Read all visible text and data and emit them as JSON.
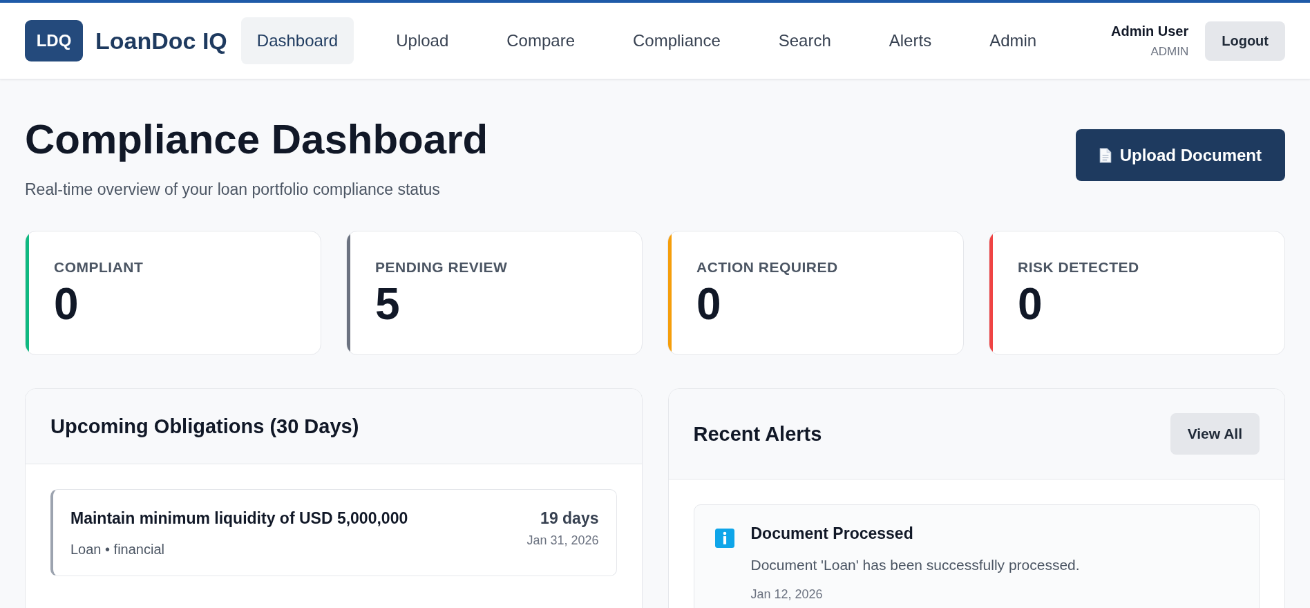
{
  "brand": {
    "logo": "LDQ",
    "name": "LoanDoc IQ"
  },
  "nav": [
    {
      "label": "Dashboard",
      "selected": true
    },
    {
      "label": "Upload",
      "selected": false
    },
    {
      "label": "Compare",
      "selected": false
    },
    {
      "label": "Compliance",
      "selected": false
    },
    {
      "label": "Search",
      "selected": false
    },
    {
      "label": "Alerts",
      "selected": false
    },
    {
      "label": "Admin",
      "selected": false
    }
  ],
  "user": {
    "name": "Admin User",
    "role": "ADMIN",
    "logout": "Logout"
  },
  "page": {
    "title": "Compliance Dashboard",
    "subtitle": "Real-time overview of your loan portfolio compliance status",
    "upload_button": "Upload Document"
  },
  "stats": [
    {
      "label": "COMPLIANT",
      "value": "0",
      "color": "#10b981"
    },
    {
      "label": "PENDING REVIEW",
      "value": "5",
      "color": "#6b7280"
    },
    {
      "label": "ACTION REQUIRED",
      "value": "0",
      "color": "#f59e0b"
    },
    {
      "label": "RISK DETECTED",
      "value": "0",
      "color": "#ef4444"
    }
  ],
  "obligations": {
    "title": "Upcoming Obligations (30 Days)",
    "items": [
      {
        "title": "Maintain minimum liquidity of USD 5,000,000",
        "meta": "Loan • financial",
        "due": "19 days",
        "date": "Jan 31, 2026"
      }
    ]
  },
  "alerts": {
    "title": "Recent Alerts",
    "view_all": "View All",
    "items": [
      {
        "title": "Document Processed",
        "message": "Document 'Loan' has been successfully processed.",
        "date": "Jan 12, 2026"
      }
    ]
  }
}
